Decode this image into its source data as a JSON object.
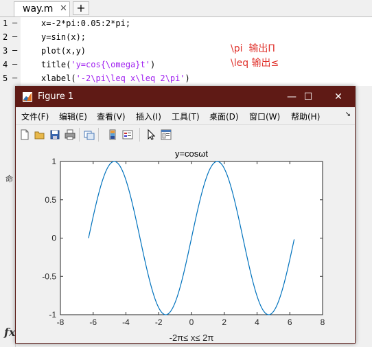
{
  "editor": {
    "tab": {
      "label": "way.m",
      "close": "✕"
    },
    "add_tab": "+",
    "lines": [
      {
        "num": "1",
        "code": "x=-2*pi:0.05:2*pi;"
      },
      {
        "num": "2",
        "code": "y=sin(x);"
      },
      {
        "num": "3",
        "code": "plot(x,y)"
      },
      {
        "num": "4",
        "code_pre": "title(",
        "code_str": "'y=cos{\\omega}t'",
        "code_post": ")"
      },
      {
        "num": "5",
        "code_pre": "xlabel(",
        "code_str": "'-2\\pi\\leq x\\leq 2\\pi'",
        "code_post": ")"
      }
    ],
    "annotation_1": "\\pi  输出Π",
    "annotation_2": "\\leq 输出≤",
    "annotation_color": "#e0342e"
  },
  "command_window": {
    "tab_label": "命",
    "fx_label": "fx"
  },
  "figure": {
    "title": "Figure 1",
    "titlebar_color": "#5f1a15",
    "buttons": {
      "minimize": "—",
      "maximize": "☐",
      "close": "✕"
    },
    "menu": [
      "文件(F)",
      "编辑(E)",
      "查看(V)",
      "插入(I)",
      "工具(T)",
      "桌面(D)",
      "窗口(W)",
      "帮助(H)"
    ],
    "menu_arrow": "↘",
    "toolbar_icons": [
      "new-figure-icon",
      "open-file-icon",
      "save-icon",
      "print-icon",
      "link-plot-icon",
      "insert-colorbar-icon",
      "insert-legend-icon",
      "pointer-icon",
      "property-inspector-icon"
    ]
  },
  "chart_data": {
    "type": "line",
    "title": "y=cosωt",
    "xlabel": "-2π≤ x≤ 2π",
    "ylabel": "",
    "xlim": [
      -8,
      8
    ],
    "ylim": [
      -1,
      1
    ],
    "xticks": [
      "-8",
      "-6",
      "-4",
      "-2",
      "0",
      "2",
      "4",
      "6",
      "8"
    ],
    "yticks": [
      "1",
      "0.5",
      "0",
      "-0.5",
      "-1"
    ],
    "line_color": "#0072bd",
    "series": [
      {
        "function": "sin(x)",
        "x_start": -6.2832,
        "x_end": 6.2832,
        "x_step": 0.05
      }
    ]
  }
}
